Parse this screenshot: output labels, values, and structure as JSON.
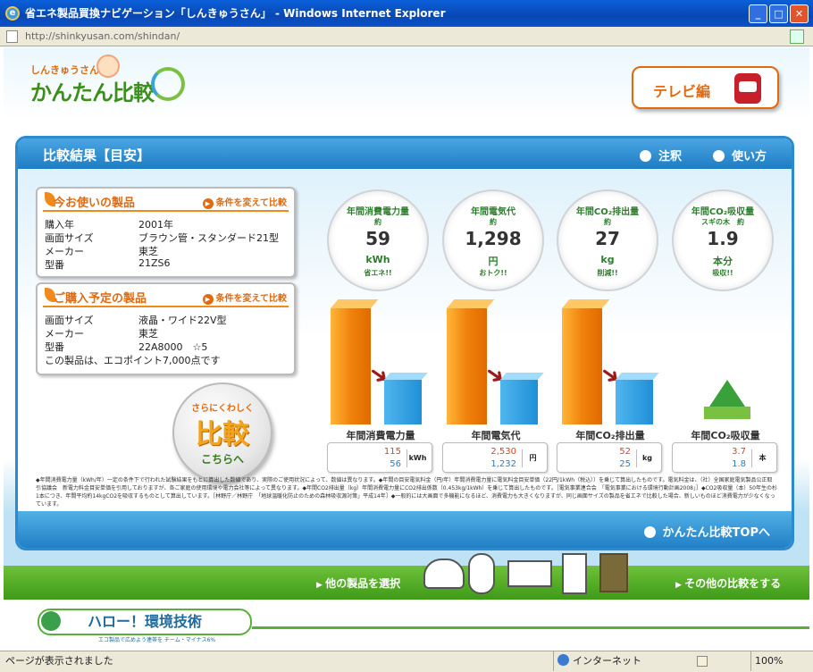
{
  "window": {
    "title": "省エネ製品買換ナビゲーション「しんきゅうさん」 - Windows Internet Explorer"
  },
  "address": {
    "url": "http://shinkyusan.com/shindan/"
  },
  "logo": {
    "small": "しんきゅうさんの",
    "main": "かんたん比較"
  },
  "tv_button": {
    "label": "テレビ編"
  },
  "panel": {
    "title": "比較結果【目安】",
    "links": {
      "notes": "注釈",
      "howto": "使い方"
    },
    "foot_link": "かんたん比較TOPへ"
  },
  "current_product": {
    "title": "今お使いの製品",
    "change_link": "条件を変えて比較",
    "rows": [
      {
        "key": "購入年",
        "value": "2001年"
      },
      {
        "key": "画面サイズ",
        "value": "ブラウン管・スタンダード21型"
      },
      {
        "key": "メーカー",
        "value": "東芝"
      },
      {
        "key": "型番",
        "value": "21ZS6"
      }
    ]
  },
  "planned_product": {
    "title": "ご購入予定の製品",
    "change_link": "条件を変えて比較",
    "rows": [
      {
        "key": "画面サイズ",
        "value": "液晶・ワイド22V型"
      },
      {
        "key": "メーカー",
        "value": "東芝"
      },
      {
        "key": "型番",
        "value": "22A8000　☆5"
      }
    ],
    "eco_point": "この製品は、エコポイント7,000点です"
  },
  "compare_button": {
    "line1": "さらにくわしく",
    "line2": "比較",
    "line3": "こちらへ"
  },
  "circles": [
    {
      "label": "年間消費電力量",
      "sub": "約",
      "value": "59",
      "unit": "kWh",
      "note": "省エネ!!"
    },
    {
      "label": "年間電気代",
      "sub": "約",
      "value": "1,298",
      "unit": "円",
      "note": "おトク!!"
    },
    {
      "label": "年間CO₂排出量",
      "sub": "約",
      "value": "27",
      "unit": "kg",
      "note": "削減!!"
    },
    {
      "label": "年間CO₂吸収量",
      "sub": "スギの木　約",
      "value": "1.9",
      "unit": "本分",
      "note": "吸収!!"
    }
  ],
  "bars": [
    {
      "label": "年間消費電力量",
      "old": "115",
      "new": "56",
      "unit": "kWh",
      "ratio": 0.49
    },
    {
      "label": "年間電気代",
      "old": "2,530",
      "new": "1,232",
      "unit": "円",
      "ratio": 0.49
    },
    {
      "label": "年間CO₂排出量",
      "old": "52",
      "new": "25",
      "unit": "kg",
      "ratio": 0.48
    },
    {
      "label": "年間CO₂吸収量",
      "old": "3.7",
      "new": "1.8",
      "unit": "本",
      "ratio": 0.49
    }
  ],
  "footnote": "◆年間消費電力量（kWh/年）一定の条件下で行われた試験結果をもとに算出した数値であり、実際のご使用状況によって、数値は異なります。◆年間の目安電気料金（円/年）年間消費電力量に電気料金目安単価（22円/1kWh（税込））を乗じて算出したものです。電気料金は、（社）全国家庭電気製品公正取引協議会　新電力料金目安単価を引用しておりますが、各ご家庭の使用環境や電力会社等によって異なります。◆年間CO2排出量（kg）年間消費電力量にCO2排出係数（0.453kg/1kWh）を乗じて算出したものです。［電気事業連合会　「電気事業における環境行動計画2008」］◆CO2吸収量（本）50年生の杉1本につき、年間平均約14kgCO2を吸収するものとして算出しています。［林野庁／林野庁　「地球温暖化防止のための森林吸収源対策」平成14年］◆一般的には大画面で多機能になるほど、消費電力も大きくなりますが、同じ画面サイズの製品を省エネで比較した場合、新しいものほど消費電力が少なくなっています。",
  "greenbar": {
    "left": "他の製品を選択",
    "right": "その他の比較をする"
  },
  "hello": {
    "title": "ハロー！環境技術",
    "sub": "エコ製品で広めよう連帯を チーム・マイナス6%"
  },
  "status": {
    "left": "ページが表示されました",
    "zone": "インターネット",
    "zoom": "100%"
  },
  "colors": {
    "orange": "#f0820c",
    "blue": "#1f8fd6",
    "green": "#3e9a18",
    "panel": "#2b8bd0"
  }
}
